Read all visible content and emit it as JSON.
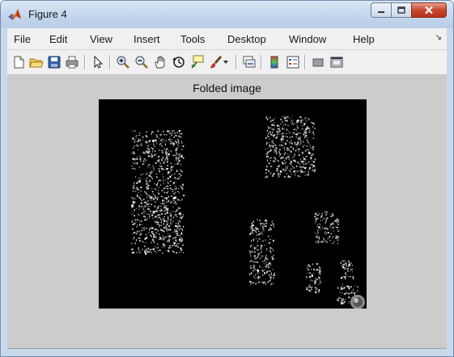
{
  "window": {
    "title": "Figure 4",
    "title_icon": "matlab-logo-icon",
    "controls": [
      "minimize-icon",
      "maximize-icon",
      "close-icon"
    ]
  },
  "menubar": {
    "items": [
      "File",
      "Edit",
      "View",
      "Insert",
      "Tools",
      "Desktop",
      "Window",
      "Help"
    ],
    "overflow_icon": "menu-overflow-arrow-icon"
  },
  "toolbar": {
    "buttons": [
      "new-figure-icon",
      "open-file-icon",
      "save-figure-icon",
      "print-figure-icon",
      "edit-plot-pointer-icon",
      "zoom-in-icon",
      "zoom-out-icon",
      "pan-hand-icon",
      "rotate-3d-icon",
      "data-cursor-icon",
      "brush-icon",
      "brush-dropdown-icon",
      "link-plot-icon",
      "insert-colorbar-icon",
      "insert-legend-icon",
      "hide-plot-tools-icon",
      "show-plot-tools-icon"
    ]
  },
  "figure": {
    "axes_title": "Folded image",
    "background_color": "#cccccc",
    "image_background": "#000000"
  }
}
